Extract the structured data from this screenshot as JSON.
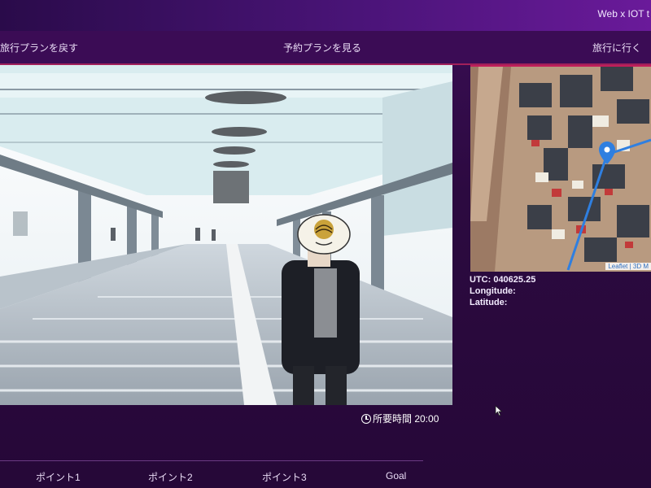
{
  "app": {
    "title": "Web x IOT t"
  },
  "nav": {
    "back_label": "旅行プランを戻す",
    "view_label": "予約プランを見る",
    "go_label": "旅行に行く"
  },
  "video": {
    "duration_label": "所要時間 20:00",
    "icon": "clock-icon"
  },
  "map": {
    "attribution": "Leaflet | 3D M",
    "marker_icon": "location-pin-icon"
  },
  "info": {
    "utc_label": "UTC: 040625.25",
    "longitude_label": "Longitude:",
    "latitude_label": "Latitude:"
  },
  "points": [
    {
      "label": "ポイント1"
    },
    {
      "label": "ポイント2"
    },
    {
      "label": "ポイント3"
    },
    {
      "label": "Goal"
    }
  ],
  "colors": {
    "background": "#2b0a3d",
    "navbar": "#3b0c55",
    "accent": "#c21d5b",
    "route": "#2f7fe0"
  }
}
